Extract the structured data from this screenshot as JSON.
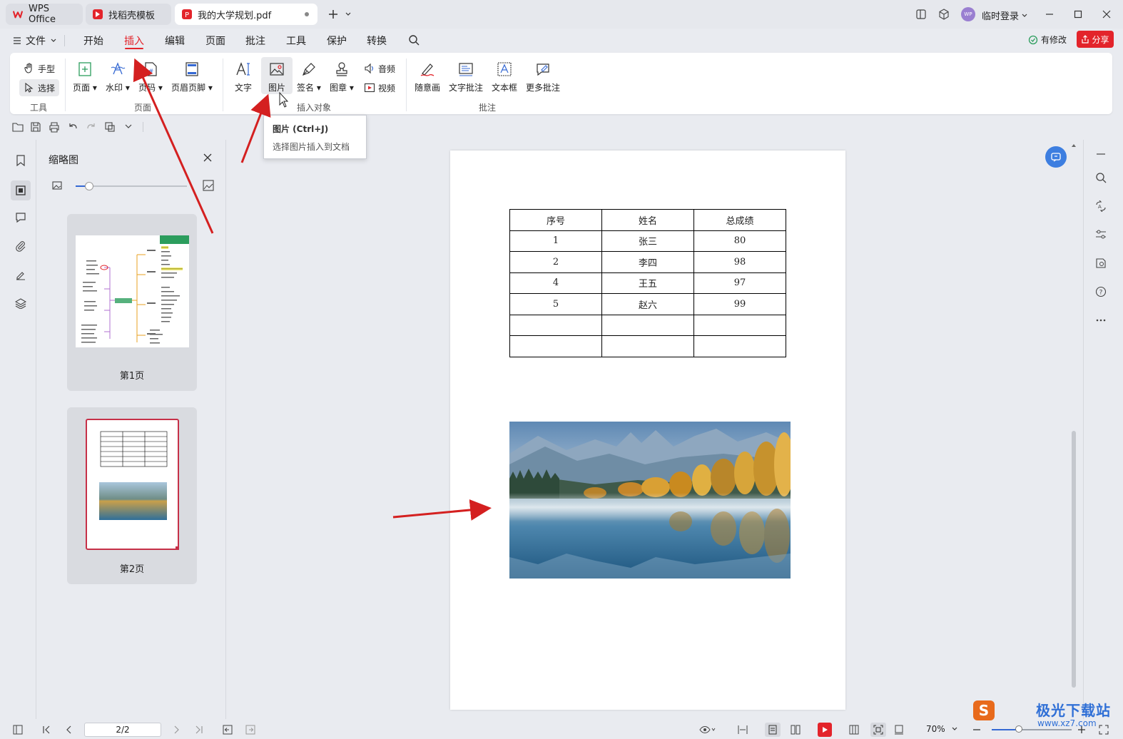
{
  "titlebar": {
    "tabs": [
      {
        "label": "WPS Office"
      },
      {
        "label": "找稻壳模板"
      },
      {
        "label": "我的大学规划.pdf"
      }
    ],
    "login_label": "临时登录"
  },
  "menubar": {
    "file_label": "文件",
    "items": [
      "开始",
      "插入",
      "编辑",
      "页面",
      "批注",
      "工具",
      "保护",
      "转换"
    ],
    "active": "插入",
    "modify_label": "有修改",
    "share_label": "分享"
  },
  "ribbon": {
    "tools": {
      "hand": "手型",
      "select": "选择",
      "group": "工具"
    },
    "page_group": {
      "page": "页面",
      "watermark": "水印",
      "pagenum": "页码",
      "headerfooter": "页眉页脚",
      "group": "页面"
    },
    "insert_group": {
      "text": "文字",
      "picture": "图片",
      "signature": "签名",
      "stamp": "图章",
      "audio": "音频",
      "video": "视频",
      "group": "插入对象"
    },
    "annot_group": {
      "freehand": "随意画",
      "textnote": "文字批注",
      "textbox": "文本框",
      "more": "更多批注",
      "group": "批注"
    }
  },
  "tooltip": {
    "title": "图片 (Ctrl+J)",
    "desc": "选择图片插入到文档"
  },
  "thumbnails": {
    "title": "缩略图",
    "zoom": 0.12,
    "pages": [
      {
        "label": "第1页"
      },
      {
        "label": "第2页"
      }
    ]
  },
  "document": {
    "table": {
      "headers": [
        "序号",
        "姓名",
        "总成绩"
      ],
      "rows": [
        [
          "1",
          "张三",
          "80"
        ],
        [
          "2",
          "李四",
          "98"
        ],
        [
          "4",
          "王五",
          "97"
        ],
        [
          "5",
          "赵六",
          "99"
        ],
        [
          "",
          "",
          ""
        ],
        [
          "",
          "",
          ""
        ]
      ]
    },
    "image": "lake-mountain-autumn-photo"
  },
  "statusbar": {
    "page_indicator": "2/2",
    "zoom": "70%"
  },
  "watermark": {
    "text": "极光下载站",
    "url": "www.xz7.com"
  },
  "colors": {
    "accent": "#e3242b",
    "ribbon_bg": "#ffffff",
    "chrome_bg": "#e9ebf0",
    "arrow": "#d42020"
  }
}
